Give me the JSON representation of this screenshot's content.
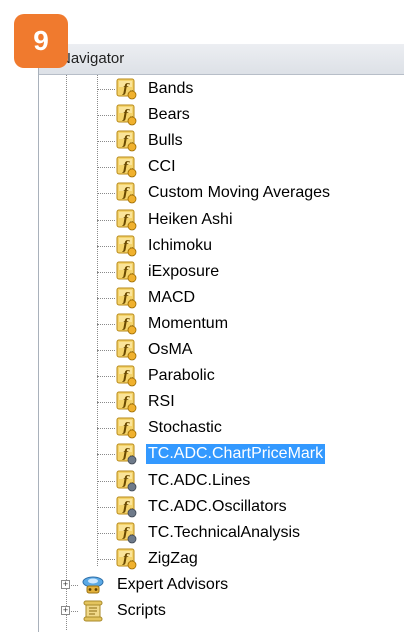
{
  "badge": "9",
  "panel": {
    "title": "Navigator"
  },
  "indicators": [
    {
      "label": "Bands",
      "type": "builtin"
    },
    {
      "label": "Bears",
      "type": "builtin"
    },
    {
      "label": "Bulls",
      "type": "builtin"
    },
    {
      "label": "CCI",
      "type": "builtin"
    },
    {
      "label": "Custom Moving Averages",
      "type": "builtin"
    },
    {
      "label": "Heiken Ashi",
      "type": "builtin"
    },
    {
      "label": "Ichimoku",
      "type": "builtin"
    },
    {
      "label": "iExposure",
      "type": "builtin"
    },
    {
      "label": "MACD",
      "type": "builtin"
    },
    {
      "label": "Momentum",
      "type": "builtin"
    },
    {
      "label": "OsMA",
      "type": "builtin"
    },
    {
      "label": "Parabolic",
      "type": "builtin"
    },
    {
      "label": "RSI",
      "type": "builtin"
    },
    {
      "label": "Stochastic",
      "type": "builtin"
    },
    {
      "label": "TC.ADC.ChartPriceMark",
      "type": "custom",
      "selected": true
    },
    {
      "label": "TC.ADC.Lines",
      "type": "custom"
    },
    {
      "label": "TC.ADC.Oscillators",
      "type": "custom"
    },
    {
      "label": "TC.TechnicalAnalysis",
      "type": "custom"
    },
    {
      "label": "ZigZag",
      "type": "builtin"
    }
  ],
  "groups": [
    {
      "label": "Expert Advisors",
      "icon": "expert-advisors-icon",
      "expander": "+"
    },
    {
      "label": "Scripts",
      "icon": "scripts-icon",
      "expander": "+"
    }
  ],
  "colors": {
    "selection": "#3399ff",
    "badge": "#f07a2e"
  }
}
